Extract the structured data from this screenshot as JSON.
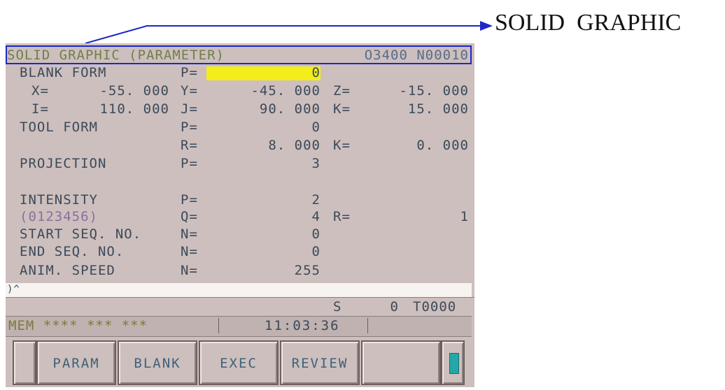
{
  "annotation": {
    "label": "SOLID  GRAPHIC",
    "arrow_color": "#1d27c9"
  },
  "header": {
    "title": "SOLID GRAPHIC (PARAMETER)",
    "program": "O3400 N00010"
  },
  "blank_form": {
    "label": "BLANK FORM",
    "p_label": "P=",
    "p_value": "0",
    "x_label": "X=",
    "x_value": "-55. 000",
    "y_label": "Y=",
    "y_value": "-45. 000",
    "z_label": "Z=",
    "z_value": "-15. 000",
    "i_label": "I=",
    "i_value": "110. 000",
    "j_label": "J=",
    "j_value": "90. 000",
    "k_label": "K=",
    "k_value": "15. 000"
  },
  "tool_form": {
    "label": "TOOL FORM",
    "p_label": "P=",
    "p_value": "0",
    "r_label": "R=",
    "r_value": "8. 000",
    "k_label": "K=",
    "k_value": "0. 000"
  },
  "projection": {
    "label": "PROJECTION",
    "p_label": "P=",
    "p_value": "3"
  },
  "intensity": {
    "label": "INTENSITY",
    "scale": "(0123456)",
    "p_label": "P=",
    "p_value": "2",
    "q_label": "Q=",
    "q_value": "4",
    "r_label": "R=",
    "r_value": "1"
  },
  "start_seq": {
    "label": "START SEQ. NO.",
    "n_label": "N=",
    "n_value": "0"
  },
  "end_seq": {
    "label": "END SEQ. NO.",
    "n_label": "N=",
    "n_value": "0"
  },
  "anim_speed": {
    "label": "ANIM. SPEED",
    "n_label": "N=",
    "n_value": "255"
  },
  "input": {
    "prompt": ")^"
  },
  "spindle": {
    "s_label": "S",
    "s_value": "0",
    "tool": "T0000"
  },
  "status": {
    "mode": "MEM **** *** ***",
    "time": "11:03:36"
  },
  "softkeys": [
    "PARAM",
    "BLANK",
    "EXEC",
    "REVIEW",
    ""
  ],
  "colors": {
    "screen": "#cdbfbd",
    "highlight": "#f3ee1a",
    "frame": "#1d27c9"
  }
}
